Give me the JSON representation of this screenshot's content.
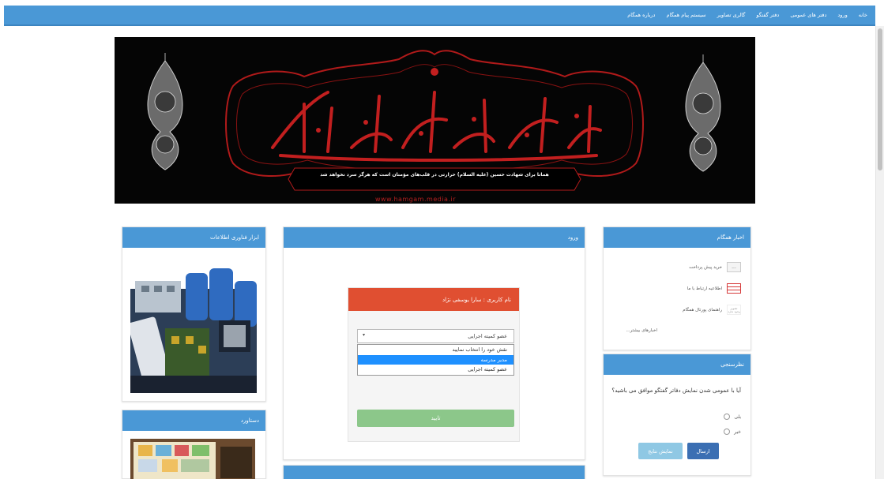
{
  "nav": {
    "items": [
      "خانه",
      "ورود",
      "دفتر های عمومی",
      "دفتر گفتگو",
      "گالری تصاویر",
      "سیستم پیام همگام",
      "درباره همگام"
    ]
  },
  "banner": {
    "caption": "همانا برای شهادت حسین (علیه السلام) حرارتی در قلب‌های مؤمنان است که هرگز سرد نخواهد شد",
    "url": "www.hamgam.media.ir"
  },
  "news": {
    "title": "اخبار همگام",
    "items": [
      {
        "thumb": "...",
        "label": "خرید پیش پرداخت"
      },
      {
        "thumb": "",
        "label": "اطلاعیه ارتباط با ما"
      },
      {
        "thumb": "تصویر وجود ندارد",
        "label": "راهنمای پورتال همگام"
      }
    ],
    "all_link": "اخبارهای بیشتر..."
  },
  "poll": {
    "title": "نظرسنجی",
    "question": "آیا با عمومی شدن نمایش دفاتر گفتگو موافق می باشید؟",
    "options": [
      "بلی",
      "خیر"
    ],
    "send_label": "ارسال",
    "results_label": "نمایش نتایج"
  },
  "login_panel": {
    "title": "ورود",
    "header": "نام کاربری : سارا یوسفی نژاد",
    "select_value": "عضو کمیته اجرایی",
    "select_arrow": "▾",
    "options": [
      "نقش خود را انتخاب نمایید",
      "مدیر مدرسه",
      "عضو کمیته اجرایی"
    ],
    "selected_index": 1,
    "submit_label": "تایید"
  },
  "left_panels": {
    "top_title": "ابزار فناوری اطلاعات",
    "bottom_title": "دستاورد"
  },
  "colors": {
    "nav_blue": "#4a98d6",
    "header_red": "#e04f31",
    "button_green": "#8cc78a",
    "dropdown_highlight": "#1e90ff"
  }
}
